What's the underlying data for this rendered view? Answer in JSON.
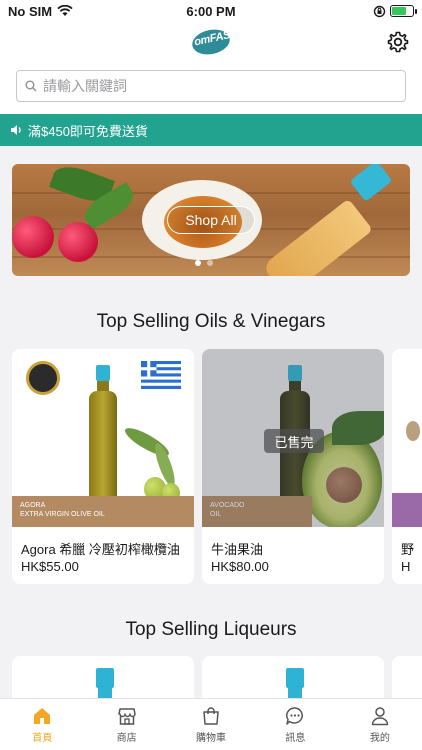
{
  "status_bar": {
    "carrier": "No SIM",
    "time": "6:00 PM"
  },
  "header": {
    "logo_text": "omFASS"
  },
  "search": {
    "placeholder": "請輸入關鍵詞"
  },
  "promo": {
    "text": "滿$450即可免費送貨"
  },
  "hero": {
    "button_label": "Shop All",
    "slide_count": 2,
    "active_slide": 1
  },
  "sections": [
    {
      "title": "Top Selling Oils & Vinegars",
      "products": [
        {
          "name": "Agora 希臘 冷壓初榨橄欖油",
          "price": "HK$55.00",
          "label_line1": "AGORA",
          "label_line2": "EXTRA VIRGIN OLIVE OIL",
          "sold_out": false
        },
        {
          "name": "牛油果油",
          "price": "HK$80.00",
          "label_line1": "AVOCADO",
          "label_line2": "OIL",
          "sold_out": true,
          "sold_out_label": "已售完"
        },
        {
          "name": "野",
          "price": "H"
        }
      ]
    },
    {
      "title": "Top Selling Liqueurs"
    }
  ],
  "tabs": [
    {
      "label": "首頁",
      "icon": "home-icon",
      "active": true
    },
    {
      "label": "商店",
      "icon": "store-icon",
      "active": false
    },
    {
      "label": "購物車",
      "icon": "shopping-bag-icon",
      "active": false
    },
    {
      "label": "訊息",
      "icon": "chat-bubble-icon",
      "active": false
    },
    {
      "label": "我的",
      "icon": "user-icon",
      "active": false
    }
  ],
  "colors": {
    "accent": "#f5a623",
    "promo_bg": "#21a38f",
    "brand": "#2e8b9a"
  }
}
